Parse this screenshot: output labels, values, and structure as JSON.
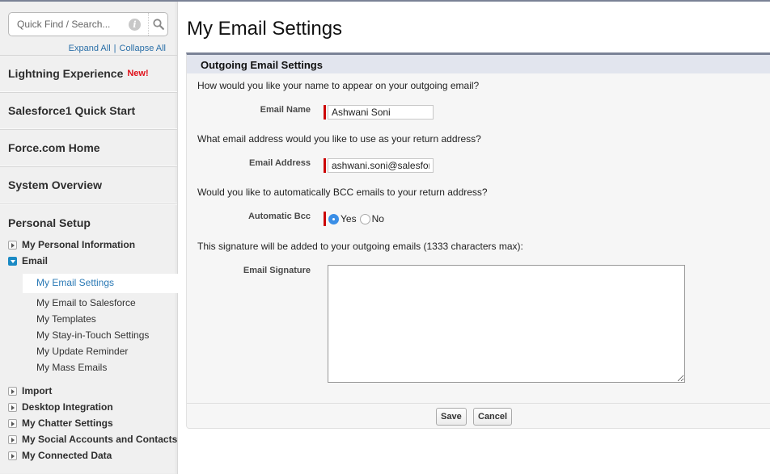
{
  "sidebar": {
    "search": {
      "placeholder": "Quick Find / Search...",
      "value": ""
    },
    "expand_all": "Expand All",
    "separator": "|",
    "collapse_all": "Collapse All",
    "sections": [
      {
        "label": "Lightning Experience",
        "badge": "New!"
      },
      {
        "label": "Salesforce1 Quick Start"
      },
      {
        "label": "Force.com Home"
      },
      {
        "label": "System Overview"
      }
    ],
    "personal_setup": {
      "title": "Personal Setup",
      "items": [
        {
          "label": "My Personal Information",
          "expanded": false
        },
        {
          "label": "Email",
          "expanded": true,
          "children": [
            {
              "label": "My Email Settings",
              "selected": true
            },
            {
              "label": "My Email to Salesforce"
            },
            {
              "label": "My Templates"
            },
            {
              "label": "My Stay-in-Touch Settings"
            },
            {
              "label": "My Update Reminder"
            },
            {
              "label": "My Mass Emails"
            }
          ]
        },
        {
          "label": "Import",
          "expanded": false
        },
        {
          "label": "Desktop Integration",
          "expanded": false
        },
        {
          "label": "My Chatter Settings",
          "expanded": false
        },
        {
          "label": "My Social Accounts and Contacts",
          "expanded": false
        },
        {
          "label": "My Connected Data",
          "expanded": false
        }
      ]
    }
  },
  "main": {
    "title": "My Email Settings",
    "panel_title": "Outgoing Email Settings",
    "q_name": "How would you like your name to appear on your outgoing email?",
    "email_name": {
      "label": "Email Name",
      "value": "Ashwani Soni"
    },
    "q_address": "What email address would you like to use as your return address?",
    "email_address": {
      "label": "Email Address",
      "value": "ashwani.soni@salesforc"
    },
    "q_bcc": "Would you like to automatically BCC emails to your return address?",
    "bcc": {
      "label": "Automatic Bcc",
      "yes": "Yes",
      "no": "No",
      "selected": "Yes"
    },
    "q_signature": "This signature will be added to your outgoing emails (1333 characters max):",
    "signature": {
      "label": "Email Signature",
      "value": ""
    },
    "save": "Save",
    "cancel": "Cancel"
  },
  "colors": {
    "required": "#cc0000",
    "link": "#2a6fa8",
    "accent": "#1b8ac4",
    "panel_border": "#7a8296"
  }
}
